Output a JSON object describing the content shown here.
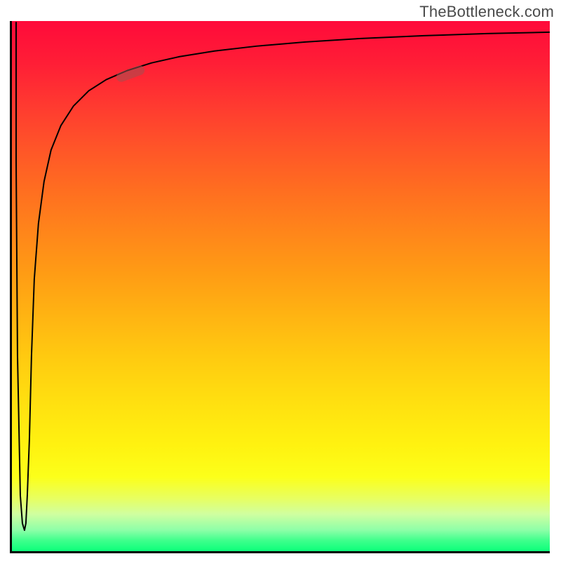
{
  "watermark": "TheBottleneck.com",
  "chart_data": {
    "type": "line",
    "title": "",
    "xlabel": "",
    "ylabel": "",
    "xlim": [
      0,
      100
    ],
    "ylim": [
      0,
      100
    ],
    "background_gradient": {
      "direction": "vertical",
      "stops": [
        {
          "pos": 0.0,
          "color": "#ff0a3a"
        },
        {
          "pos": 0.4,
          "color": "#ff861a"
        },
        {
          "pos": 0.8,
          "color": "#fff210"
        },
        {
          "pos": 1.0,
          "color": "#0cff7a"
        }
      ]
    },
    "series": [
      {
        "name": "bottleneck_curve",
        "x": [
          0.8,
          1.0,
          1.5,
          2.0,
          2.5,
          3.0,
          3.5,
          4.0,
          5.0,
          6.0,
          8.0,
          10,
          14,
          18,
          25,
          35,
          50,
          70,
          90,
          100
        ],
        "y": [
          100,
          37,
          5,
          4,
          5,
          10,
          22,
          37,
          52,
          64,
          76,
          82,
          87,
          89,
          91,
          93,
          95,
          97,
          98,
          98
        ]
      }
    ],
    "marker": {
      "approx_x": 20,
      "approx_y": 90,
      "shape": "pill",
      "color": "rgba(160,80,80,0.55)"
    },
    "axes_visible": false,
    "border": {
      "left": true,
      "bottom": true,
      "top": false,
      "right": false
    }
  }
}
